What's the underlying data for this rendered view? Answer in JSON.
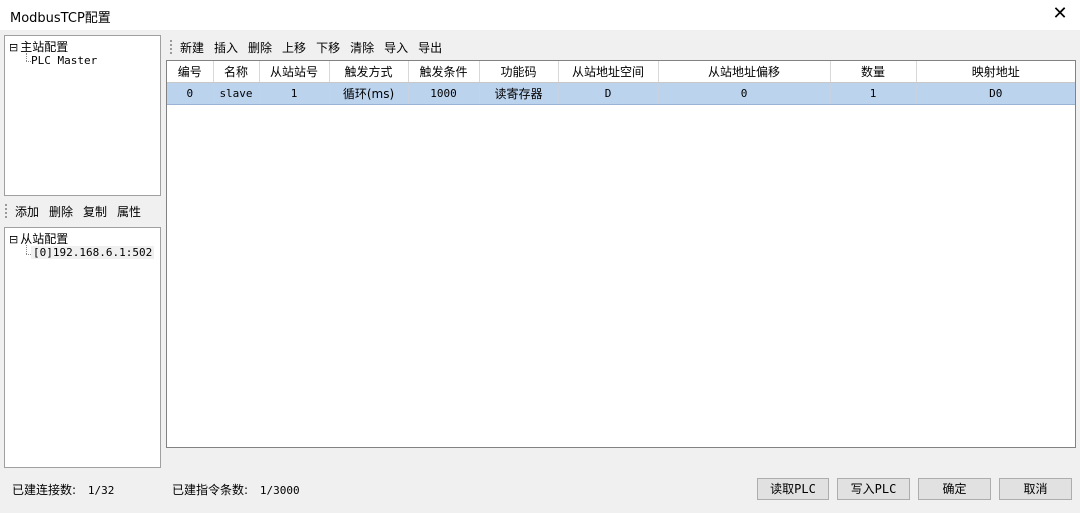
{
  "window": {
    "title": "ModbusTCP配置",
    "close_glyph": "✕"
  },
  "master_tree": {
    "root_label": "主站配置",
    "child_label": "PLC Master",
    "expander": "⊟"
  },
  "slave_toolbar": {
    "items": [
      "添加",
      "删除",
      "复制",
      "属性"
    ]
  },
  "slave_tree": {
    "root_label": "从站配置",
    "child_label": "[0]192.168.6.1:502",
    "expander": "⊟"
  },
  "command_toolbar": {
    "items": [
      "新建",
      "插入",
      "删除",
      "上移",
      "下移",
      "清除",
      "导入",
      "导出"
    ]
  },
  "table": {
    "columns": [
      "编号",
      "名称",
      "从站站号",
      "触发方式",
      "触发条件",
      "功能码",
      "从站地址空间",
      "从站地址偏移",
      "数量",
      "映射地址"
    ],
    "rows": [
      [
        "0",
        "slave",
        "1",
        "循环(ms)",
        "1000",
        "读寄存器",
        "D",
        "0",
        "1",
        "D0"
      ]
    ],
    "selected_row_color": "#bcd3ee"
  },
  "status": {
    "connections_label": "已建连接数:",
    "connections_value": "1/32",
    "commands_label": "已建指令条数:",
    "commands_value": "1/3000"
  },
  "buttons": {
    "read_plc": "读取PLC",
    "write_plc": "写入PLC",
    "ok": "确定",
    "cancel": "取消"
  }
}
